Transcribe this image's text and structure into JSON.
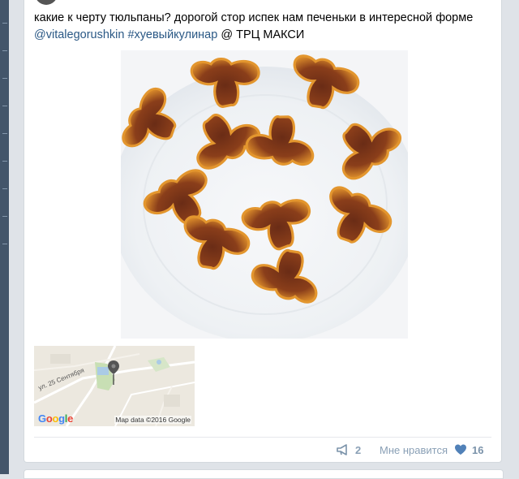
{
  "post": {
    "text_main": "какие к черту тюльпаны? дорогой стор испек нам  печеньки в интересной форме",
    "mention": "@vitalegorushkin",
    "hashtag": "#хуевыйкулинар",
    "location": "@ ТРЦ МАКСИ"
  },
  "map": {
    "street": "ул. 25 Сентября",
    "logo": "Google",
    "credit": "Map data ©2016 Google"
  },
  "actions": {
    "share_count": "2",
    "like_label": "Мне нравится",
    "like_count": "16"
  },
  "colors": {
    "link": "#2a5885",
    "action": "#8aa0b6",
    "heart": "#5181b8",
    "rail": "#43556a"
  },
  "icons": {
    "share": "megaphone-icon",
    "like": "heart-icon",
    "map_pin": "map-pin-icon"
  }
}
